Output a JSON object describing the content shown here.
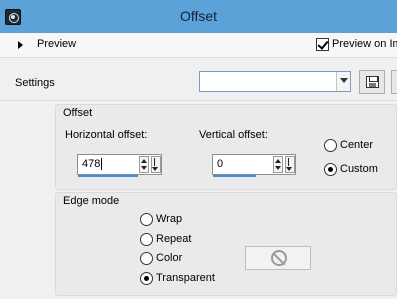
{
  "window": {
    "title": "Offset",
    "icon": "app-camera-icon"
  },
  "preview": {
    "label": "Preview",
    "preview_on_label": "Preview on Im",
    "preview_on_checked": true
  },
  "settings": {
    "label": "Settings",
    "value": "",
    "save_icon": "floppy-disk-icon"
  },
  "offset": {
    "group_title": "Offset",
    "horizontal_label": "Horizontal offset:",
    "horizontal_value": "478",
    "vertical_label": "Vertical offset:",
    "vertical_value": "0",
    "options": [
      {
        "label": "Center",
        "checked": false
      },
      {
        "label": "Custom",
        "checked": true
      }
    ]
  },
  "edge_mode": {
    "group_title": "Edge mode",
    "options": [
      {
        "label": "Wrap",
        "checked": false
      },
      {
        "label": "Repeat",
        "checked": false
      },
      {
        "label": "Color",
        "checked": false
      },
      {
        "label": "Transparent",
        "checked": true
      }
    ],
    "color_swatch_icon": "no-color-icon"
  },
  "colors": {
    "titlebar": "#5ba2d8",
    "focus_underline": "#3d8ee0"
  }
}
